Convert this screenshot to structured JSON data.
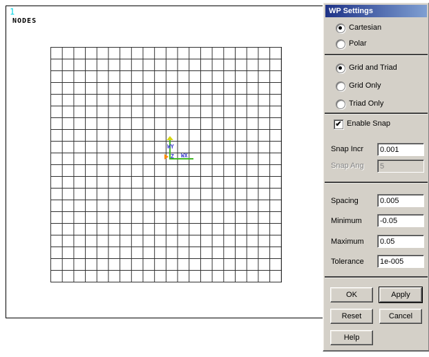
{
  "graphics": {
    "window_id": "1",
    "annotation": "NODES",
    "grid": {
      "columns": 20,
      "rows": 20
    },
    "triad": {
      "wy_label": "WY",
      "wx_label": "WX",
      "wz_label": "Z"
    }
  },
  "dialog": {
    "title": "WP Settings",
    "coordinate_type": {
      "options": [
        {
          "label": "Cartesian",
          "selected": true
        },
        {
          "label": "Polar",
          "selected": false
        }
      ]
    },
    "display_mode": {
      "options": [
        {
          "label": "Grid and Triad",
          "selected": true
        },
        {
          "label": "Grid Only",
          "selected": false
        },
        {
          "label": "Triad Only",
          "selected": false
        }
      ]
    },
    "snap": {
      "enable_label": "Enable Snap",
      "enabled": true,
      "checkmark": "✔",
      "incr_label": "Snap Incr",
      "incr_value": "0.001",
      "ang_label": "Snap Ang",
      "ang_value": "5",
      "ang_disabled": true
    },
    "grid_params": {
      "spacing_label": "Spacing",
      "spacing_value": "0.005",
      "minimum_label": "Minimum",
      "minimum_value": "-0.05",
      "maximum_label": "Maximum",
      "maximum_value": "0.05",
      "tolerance_label": "Tolerance",
      "tolerance_value": "1e-005"
    },
    "buttons": {
      "ok": "OK",
      "apply": "Apply",
      "reset": "Reset",
      "cancel": "Cancel",
      "help": "Help"
    }
  },
  "colors": {
    "titlebar_gradient_left": "#1e3287",
    "titlebar_gradient_right": "#7f9fd2",
    "dialog_background": "#d4d0c8",
    "window_id_cyan": "#00d4e4",
    "triad_axis_green": "#3fb822",
    "triad_label_blue": "#3a3acc",
    "triad_origin_orange": "#ff8a00",
    "grid_line": "#2e2e2e"
  }
}
